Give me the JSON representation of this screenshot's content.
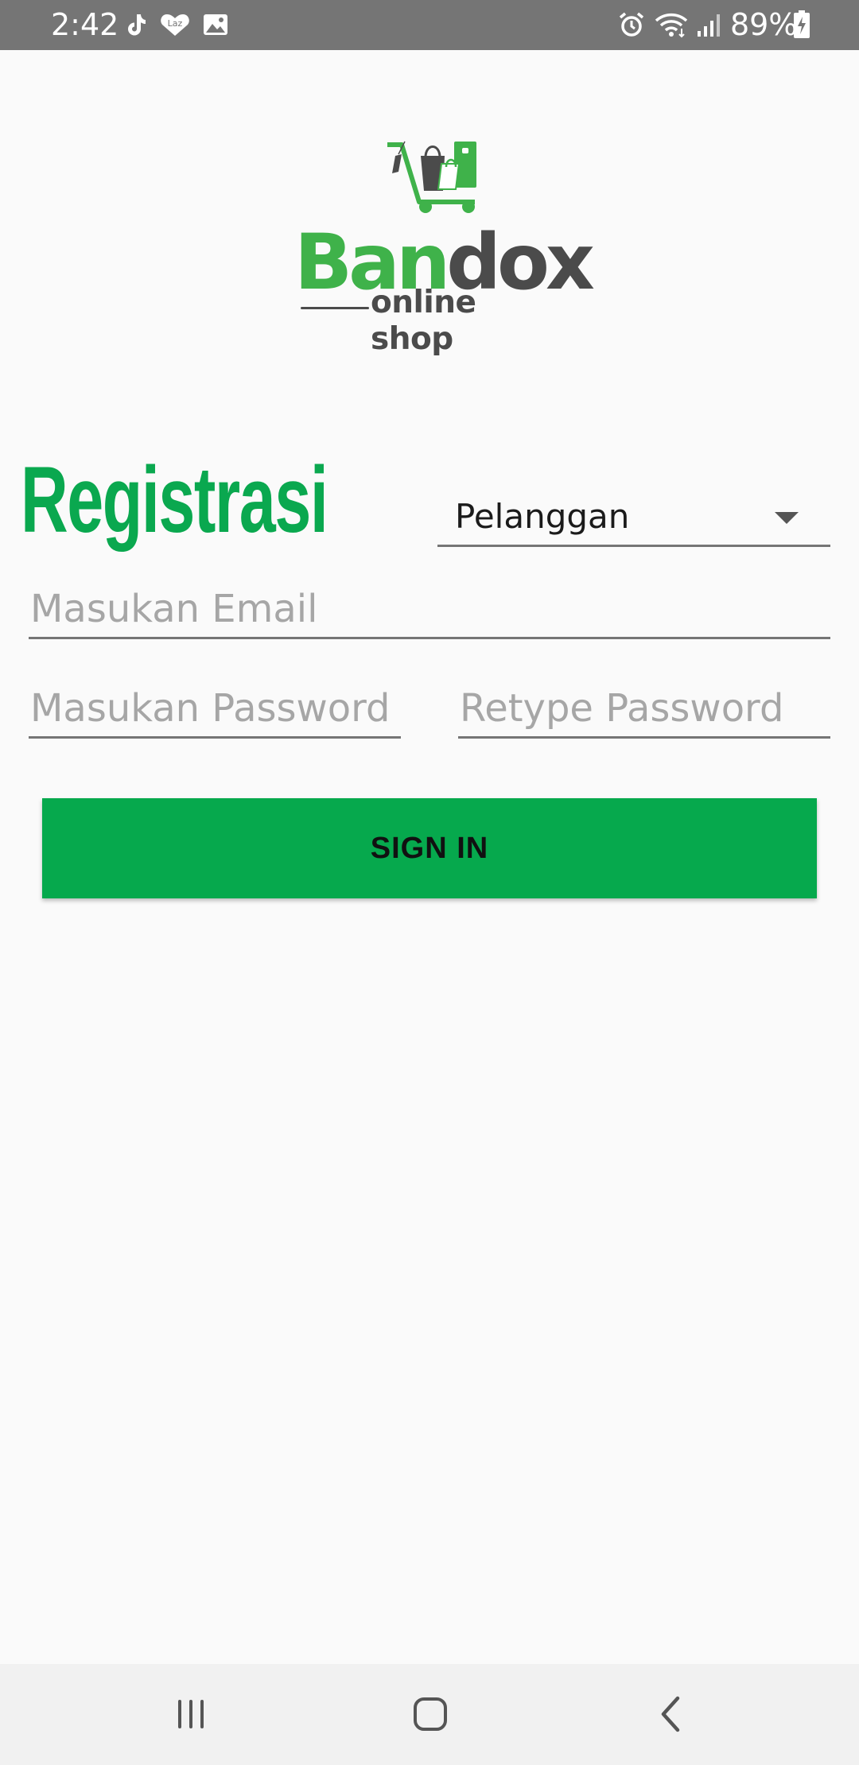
{
  "status_bar": {
    "time": "2:42",
    "battery": "89%",
    "icons": [
      "tiktok-icon",
      "lazada-icon",
      "gallery-icon",
      "alarm-icon",
      "wifi-icon",
      "signal-icon",
      "battery-charging-icon"
    ]
  },
  "logo": {
    "brand_part1": "Ban",
    "brand_part2": "dox",
    "subtitle": "online shop"
  },
  "form": {
    "title": "Registrasi",
    "role_selected": "Pelanggan",
    "email_placeholder": "Masukan Email",
    "password_placeholder": "Masukan Password",
    "retype_placeholder": "Retype Password",
    "submit_label": "SIGN IN"
  },
  "nav_bar": {
    "buttons": [
      "recents-button",
      "home-button",
      "back-button"
    ]
  },
  "colors": {
    "accent_green": "#06a94d",
    "logo_green": "#3fb24a",
    "logo_gray": "#4b4b4b",
    "status_bar": "#757575"
  }
}
